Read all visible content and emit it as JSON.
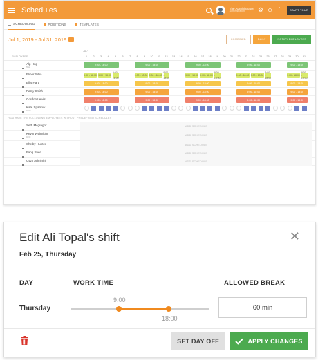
{
  "app": {
    "title": "Schedules",
    "user_name": "The Administrator",
    "user_role": "Administration",
    "start_tour": "START TOUR",
    "tabs": [
      {
        "label": "SCHEDULING",
        "active": true
      },
      {
        "label": "POSITIONS",
        "active": false
      },
      {
        "label": "TEMPLATES",
        "active": false
      }
    ],
    "date_range": "Jul 1, 2019 - Jul 31, 2019",
    "view_buttons": {
      "combined": "COMBINED",
      "daily": "DAILY",
      "notify": "NOTIFY EMPLOYEES"
    },
    "employees_header": "EMPLOYEES",
    "month_label": "JULY",
    "days": [
      1,
      2,
      3,
      4,
      5,
      6,
      7,
      8,
      9,
      10,
      11,
      12,
      13,
      14,
      15,
      16,
      17,
      18,
      19,
      20,
      21,
      22,
      23,
      24,
      25,
      26,
      27,
      28,
      29,
      30,
      31
    ],
    "shift_label": "9:00 - 18:00",
    "scheduled_employees": [
      {
        "name": "Alp Hug",
        "sub": "Test",
        "pattern": "green"
      },
      {
        "name": "Elinor Silva",
        "sub": "",
        "pattern": "lime"
      },
      {
        "name": "Ellis Hart",
        "sub": "",
        "pattern": "yellow"
      },
      {
        "name": "Patsy Smith",
        "sub": "",
        "pattern": "orange"
      },
      {
        "name": "Gordon Lewis",
        "sub": "",
        "pattern": "red"
      },
      {
        "name": "Kate Sparrow",
        "sub": "CEO",
        "pattern": "blue"
      }
    ],
    "notice": "YOU HAVE THE FOLLOWING EMPLOYEES WITHOUT PREDEFINED SCHEDULES",
    "unscheduled_employees": [
      {
        "name": "Seth Mcgregor",
        "sub": ""
      },
      {
        "name": "Kevin Wainright",
        "sub": "CFO"
      },
      {
        "name": "Shelby Hunter",
        "sub": ""
      },
      {
        "name": "Fang Shen",
        "sub": ""
      },
      {
        "name": "Ozzy Adminini",
        "sub": ""
      }
    ],
    "add_schedule": "ADD SCHEDULE"
  },
  "modal": {
    "title": "Edit Ali Topal's shift",
    "date": "Feb 25, Thursday",
    "col_day": "DAY",
    "col_work_time": "WORK TIME",
    "col_break": "ALLOWED BREAK",
    "day": "Thursday",
    "start": "9:00",
    "end": "18:00",
    "start_fraction": 0.35,
    "end_fraction": 0.71,
    "break_value": "60 min",
    "set_day_off": "SET DAY OFF",
    "apply": "APPLY CHANGES",
    "colors": {
      "accent": "#f08a1f",
      "apply": "#4caa4f",
      "delete": "#d9342b"
    }
  }
}
